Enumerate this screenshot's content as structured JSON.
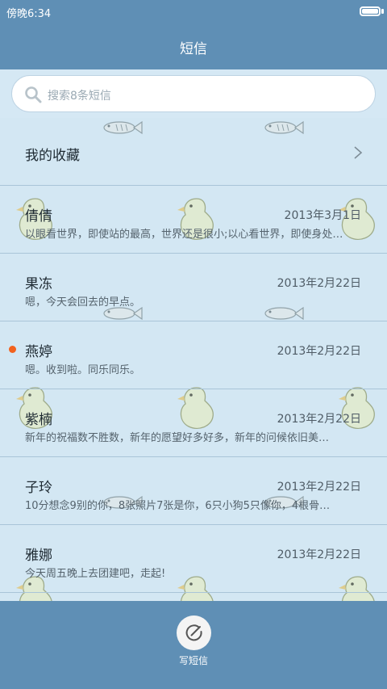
{
  "status_bar": {
    "time": "傍晚6:34"
  },
  "header": {
    "title": "短信"
  },
  "search": {
    "placeholder": "搜索8条短信"
  },
  "favorites": {
    "label": "我的收藏"
  },
  "messages": [
    {
      "name": "倩倩",
      "date": "2013年3月1日",
      "preview": "以眼看世界，即使站的最高，世界还是很小;以心看世界，即使身处…",
      "unread": false
    },
    {
      "name": "果冻",
      "date": "2013年2月22日",
      "preview": "嗯，今天会回去的早点。",
      "unread": false
    },
    {
      "name": "燕婷",
      "date": "2013年2月22日",
      "preview": "嗯。收到啦。同乐同乐。",
      "unread": true
    },
    {
      "name": "紫楠",
      "date": "2013年2月22日",
      "preview": "新年的祝福数不胜数，新年的愿望好多好多，新年的问候依旧美…",
      "unread": false
    },
    {
      "name": "子玲",
      "date": "2013年2月22日",
      "preview": "10分想念9别的你，8张照片7张是你，6只小狗5只像你，4根骨…",
      "unread": false
    },
    {
      "name": "雅娜",
      "date": "2013年2月22日",
      "preview": "今天周五晚上去团建吧，走起!",
      "unread": false
    }
  ],
  "bottom": {
    "compose_label": "写短信"
  },
  "colors": {
    "bar": "#5f8fb5",
    "list_bg": "#d3e7f3",
    "unread": "#f2621e"
  }
}
